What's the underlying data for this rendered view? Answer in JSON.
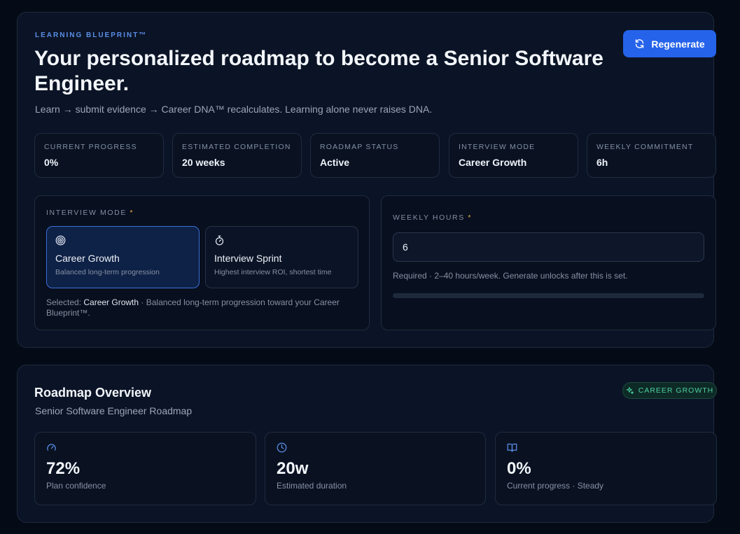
{
  "hero": {
    "eyebrow": "LEARNING BLUEPRINT™",
    "title": "Your personalized roadmap to become a Senior Software Engineer.",
    "subtitle": "Learn → submit evidence → Career DNA™ recalculates. Learning alone never raises DNA.",
    "regenerate_label": "Regenerate"
  },
  "stats": [
    {
      "label": "CURRENT PROGRESS",
      "value": "0%"
    },
    {
      "label": "ESTIMATED COMPLETION",
      "value": "20 weeks"
    },
    {
      "label": "ROADMAP STATUS",
      "value": "Active"
    },
    {
      "label": "INTERVIEW MODE",
      "value": "Career Growth"
    },
    {
      "label": "WEEKLY COMMITMENT",
      "value": "6h"
    }
  ],
  "interview_mode": {
    "label": "INTERVIEW MODE",
    "required_mark": "*",
    "options": [
      {
        "title": "Career Growth",
        "description": "Balanced long-term progression",
        "icon": "target-icon",
        "selected": true
      },
      {
        "title": "Interview Sprint",
        "description": "Highest interview ROI, shortest time",
        "icon": "stopwatch-icon",
        "selected": false
      }
    ],
    "selected_prefix": "Selected: ",
    "selected_name": "Career Growth",
    "selected_suffix": " · Balanced long-term progression toward your Career Blueprint™."
  },
  "weekly_hours": {
    "label": "WEEKLY HOURS",
    "required_mark": "*",
    "value": "6",
    "help": "Required · 2–40 hours/week. Generate unlocks after this is set.",
    "progress": 0
  },
  "overview": {
    "title": "Roadmap Overview",
    "subtitle": "Senior Software Engineer Roadmap",
    "badge": "CAREER GROWTH",
    "metrics": [
      {
        "value": "72%",
        "label": "Plan confidence",
        "icon": "gauge-icon"
      },
      {
        "value": "20w",
        "label": "Estimated duration",
        "icon": "clock-icon"
      },
      {
        "value": "0%",
        "label": "Current progress · Steady",
        "icon": "book-icon"
      }
    ]
  },
  "colors": {
    "accent": "#2563eb",
    "badge_green": "#4fd1a1",
    "required": "#e8b84b",
    "icon_blue": "#5b8fe8"
  }
}
